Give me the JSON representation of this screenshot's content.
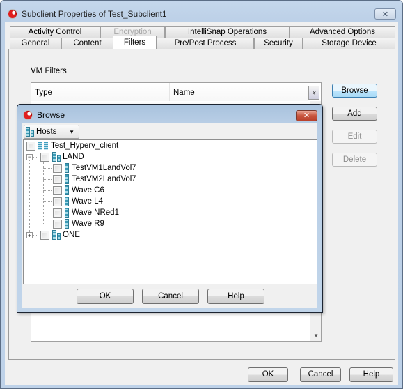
{
  "window": {
    "title": "Subclient Properties of Test_Subclient1",
    "close_glyph": "✕"
  },
  "tabs": {
    "row_top": [
      {
        "label": "Activity Control",
        "enabled": true
      },
      {
        "label": "Encryption",
        "enabled": false
      },
      {
        "label": "IntelliSnap Operations",
        "enabled": true
      },
      {
        "label": "Advanced Options",
        "enabled": true
      }
    ],
    "row_bottom": [
      {
        "label": "General",
        "enabled": true
      },
      {
        "label": "Content",
        "enabled": true
      },
      {
        "label": "Filters",
        "enabled": true,
        "active": true
      },
      {
        "label": "Pre/Post Process",
        "enabled": true
      },
      {
        "label": "Security",
        "enabled": true
      },
      {
        "label": "Storage Device",
        "enabled": true
      }
    ]
  },
  "filters": {
    "section_label": "VM Filters",
    "columns": [
      "Type",
      "Name"
    ],
    "column_picker_glyph": "»",
    "scroll_down_glyph": "▼",
    "buttons": {
      "browse": "Browse",
      "add": "Add",
      "edit": "Edit",
      "delete": "Delete"
    }
  },
  "footer": {
    "ok": "OK",
    "cancel": "Cancel",
    "help": "Help"
  },
  "browse_dialog": {
    "title": "Browse",
    "close_glyph": "✕",
    "view_selector": {
      "value": "Hosts",
      "caret": "▼"
    },
    "tree": {
      "root": {
        "label": "Test_Hyperv_client",
        "checked": false
      },
      "hosts": [
        {
          "label": "LAND",
          "expanded": true,
          "expander": "−",
          "checked": false,
          "children": [
            {
              "label": "TestVM1LandVol7",
              "checked": false
            },
            {
              "label": "TestVM2LandVol7",
              "checked": false
            },
            {
              "label": "Wave C6",
              "checked": false
            },
            {
              "label": "Wave L4",
              "checked": false
            },
            {
              "label": "Wave NRed1",
              "checked": false
            },
            {
              "label": "Wave R9",
              "checked": false
            }
          ]
        },
        {
          "label": "ONE",
          "expanded": false,
          "expander": "+",
          "checked": false,
          "children": []
        }
      ]
    },
    "buttons": {
      "ok": "OK",
      "cancel": "Cancel",
      "help": "Help"
    }
  }
}
